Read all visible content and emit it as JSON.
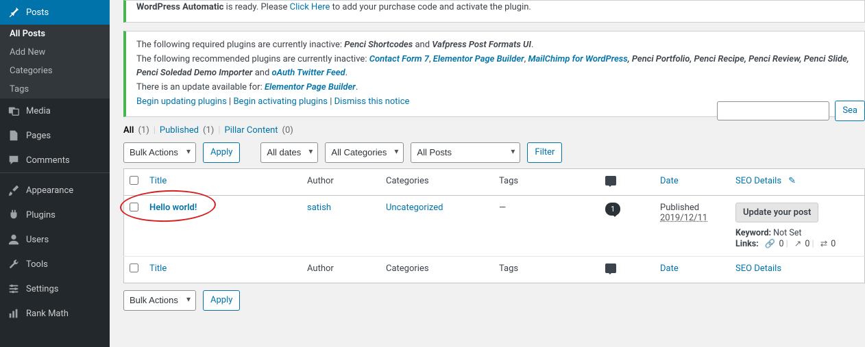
{
  "sidebar": {
    "posts": "Posts",
    "submenu": [
      "All Posts",
      "Add New",
      "Categories",
      "Tags"
    ],
    "media": "Media",
    "pages": "Pages",
    "comments": "Comments",
    "appearance": "Appearance",
    "plugins": "Plugins",
    "users": "Users",
    "tools": "Tools",
    "settings": "Settings",
    "rankmath": "Rank Math"
  },
  "notice_automatic": {
    "prefix_bold": "WordPress Automatic",
    "text1": " is ready. Please ",
    "click": "Click Here",
    "text2": " to add your purchase code and activate the plugin."
  },
  "notice_plugins": {
    "req_text": "The following required plugins are currently inactive: ",
    "req_items_italic": "Penci Shortcodes",
    "req_and": " and ",
    "req_items_italic2": "Vafpress Post Formats UI",
    "rec_text": "The following recommended plugins are currently inactive: ",
    "rec_links": [
      "Contact Form 7",
      "Elementor Page Builder",
      "MailChimp for WordPress"
    ],
    "rec_plain": [
      ", Penci Portfolio",
      ", Penci Recipe",
      ", Penci Review",
      ", Penci Slide",
      ", Penci Soledad Demo Importer"
    ],
    "rec_and": " and ",
    "rec_last_link": "oAuth Twitter Feed",
    "update_text": "There is an update available for: ",
    "update_link": "Elementor Page Builder",
    "action_update": "Begin updating plugins",
    "action_activate": "Begin activating plugins",
    "action_dismiss": "Dismiss this notice",
    "sep": " | "
  },
  "filters": {
    "all": "All",
    "all_count": "(1)",
    "published": "Published",
    "published_count": "(1)",
    "pillar": "Pillar Content",
    "pillar_count": "(0)"
  },
  "tablenav": {
    "bulk": "Bulk Actions",
    "apply": "Apply",
    "dates": "All dates",
    "cats": "All Categories",
    "allposts": "All Posts",
    "filter": "Filter",
    "search": "Sea"
  },
  "columns": {
    "title": "Title",
    "author": "Author",
    "categories": "Categories",
    "tags": "Tags",
    "date": "Date",
    "seo": "SEO Details"
  },
  "row": {
    "title": "Hello world!",
    "author": "satish",
    "category": "Uncategorized",
    "tags": "—",
    "comments": "1",
    "date_label": "Published",
    "date_value": "2019/12/11",
    "seo_btn": "Update your post",
    "keyword_label": "Keyword:",
    "keyword_value": " Not Set",
    "links_label": "Links:",
    "links_internal": "0",
    "links_external": "0",
    "links_incoming": "0"
  }
}
